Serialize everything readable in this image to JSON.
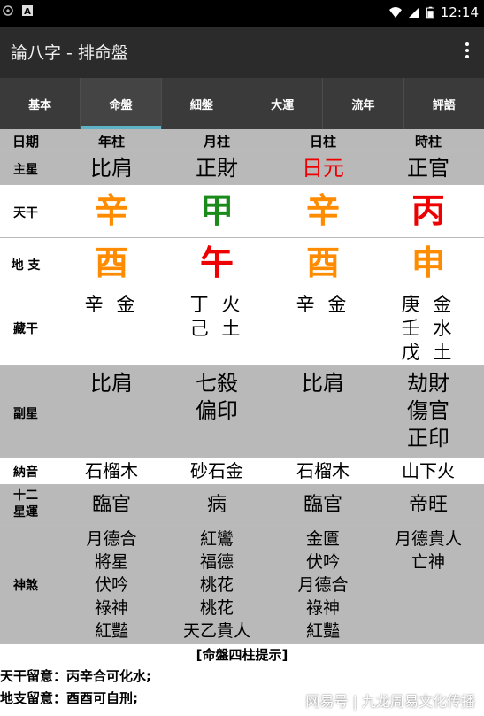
{
  "status_bar": {
    "time": "12:14"
  },
  "app_bar": {
    "title": "論八字 - 排命盤"
  },
  "tabs": [
    {
      "label": "基本",
      "active": false
    },
    {
      "label": "命盤",
      "active": true
    },
    {
      "label": "細盤",
      "active": false
    },
    {
      "label": "大運",
      "active": false
    },
    {
      "label": "流年",
      "active": false
    },
    {
      "label": "評語",
      "active": false
    }
  ],
  "table": {
    "header": {
      "label": "日期",
      "cols": [
        "年柱",
        "月柱",
        "日柱",
        "時柱"
      ]
    },
    "main_star": {
      "label": "主星",
      "cols": [
        "比肩",
        "正財",
        "日元",
        "正官"
      ]
    },
    "heavenly_stems": {
      "label": "天干",
      "cols": [
        "辛",
        "甲",
        "辛",
        "丙"
      ]
    },
    "earthly_branches": {
      "label": "地 支",
      "cols": [
        "酉",
        "午",
        "酉",
        "申"
      ]
    },
    "hidden_stems": {
      "label": "藏干",
      "cols": [
        [
          "辛 金"
        ],
        [
          "丁 火",
          "己 土"
        ],
        [
          "辛 金"
        ],
        [
          "庚 金",
          "壬 水",
          "戊 土"
        ]
      ]
    },
    "secondary_stars": {
      "label": "副星",
      "cols": [
        [
          "比肩"
        ],
        [
          "七殺",
          "偏印"
        ],
        [
          "比肩"
        ],
        [
          "劫財",
          "傷官",
          "正印"
        ]
      ]
    },
    "nayin": {
      "label": "納音",
      "cols": [
        "石榴木",
        "砂石金",
        "石榴木",
        "山下火"
      ]
    },
    "twelve_stages": {
      "label_line1": "十二",
      "label_line2": "星運",
      "cols": [
        "臨官",
        "病",
        "臨官",
        "帝旺"
      ]
    },
    "spirits": {
      "label": "神煞",
      "cols": [
        [
          "月德合",
          "將星",
          "伏吟",
          "祿神",
          "紅豔"
        ],
        [
          "紅鸞",
          "福德",
          "桃花",
          "桃花",
          "天乙貴人"
        ],
        [
          "金匱",
          "伏吟",
          "月德合",
          "祿神",
          "紅豔"
        ],
        [
          "月德貴人",
          "亡神"
        ]
      ]
    }
  },
  "tips": {
    "title": "[命盤四柱提示]",
    "lines": [
      "天干留意：丙辛合可化水;",
      "地支留意：酉酉可自刑;"
    ]
  },
  "watermark": "网易号 | 九龙周易文化传播",
  "colors": {
    "orange": "#ff8c00",
    "green": "#1a8a1a",
    "red": "#ee0000",
    "tab_indicator": "#5fb3c6",
    "row_gray": "#b9b9b9"
  }
}
